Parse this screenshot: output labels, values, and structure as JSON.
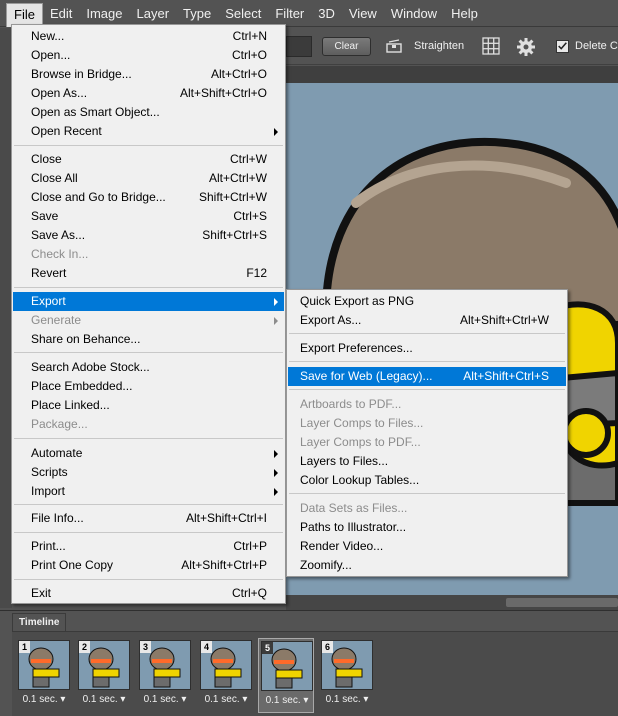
{
  "menubar": {
    "items": [
      "File",
      "Edit",
      "Image",
      "Layer",
      "Type",
      "Select",
      "Filter",
      "3D",
      "View",
      "Window",
      "Help"
    ]
  },
  "optionsbar": {
    "clear_label": "Clear",
    "straighten_label": "Straighten",
    "delete_label": "Delete Cro",
    "delete_checked": true
  },
  "file_menu": {
    "items": [
      {
        "label": "New...",
        "shortcut": "Ctrl+N"
      },
      {
        "label": "Open...",
        "shortcut": "Ctrl+O"
      },
      {
        "label": "Browse in Bridge...",
        "shortcut": "Alt+Ctrl+O"
      },
      {
        "label": "Open As...",
        "shortcut": "Alt+Shift+Ctrl+O"
      },
      {
        "label": "Open as Smart Object...",
        "shortcut": ""
      },
      {
        "label": "Open Recent",
        "shortcut": "",
        "submenu": true
      },
      {
        "label": "Close",
        "shortcut": "Ctrl+W"
      },
      {
        "label": "Close All",
        "shortcut": "Alt+Ctrl+W"
      },
      {
        "label": "Close and Go to Bridge...",
        "shortcut": "Shift+Ctrl+W"
      },
      {
        "label": "Save",
        "shortcut": "Ctrl+S"
      },
      {
        "label": "Save As...",
        "shortcut": "Shift+Ctrl+S"
      },
      {
        "label": "Check In...",
        "shortcut": "",
        "disabled": true
      },
      {
        "label": "Revert",
        "shortcut": "F12"
      },
      {
        "label": "Export",
        "shortcut": "",
        "submenu": true,
        "highlighted": true
      },
      {
        "label": "Generate",
        "shortcut": "",
        "submenu": true,
        "disabled": true
      },
      {
        "label": "Share on Behance...",
        "shortcut": ""
      },
      {
        "label": "Search Adobe Stock...",
        "shortcut": ""
      },
      {
        "label": "Place Embedded...",
        "shortcut": ""
      },
      {
        "label": "Place Linked...",
        "shortcut": ""
      },
      {
        "label": "Package...",
        "shortcut": "",
        "disabled": true
      },
      {
        "label": "Automate",
        "shortcut": "",
        "submenu": true
      },
      {
        "label": "Scripts",
        "shortcut": "",
        "submenu": true
      },
      {
        "label": "Import",
        "shortcut": "",
        "submenu": true
      },
      {
        "label": "File Info...",
        "shortcut": "Alt+Shift+Ctrl+I"
      },
      {
        "label": "Print...",
        "shortcut": "Ctrl+P"
      },
      {
        "label": "Print One Copy",
        "shortcut": "Alt+Shift+Ctrl+P"
      },
      {
        "label": "Exit",
        "shortcut": "Ctrl+Q"
      }
    ]
  },
  "export_menu": {
    "items": [
      {
        "label": "Quick Export as PNG",
        "shortcut": ""
      },
      {
        "label": "Export As...",
        "shortcut": "Alt+Shift+Ctrl+W"
      },
      {
        "label": "Export Preferences...",
        "shortcut": ""
      },
      {
        "label": "Save for Web (Legacy)...",
        "shortcut": "Alt+Shift+Ctrl+S",
        "highlighted": true
      },
      {
        "label": "Artboards to PDF...",
        "shortcut": "",
        "disabled": true
      },
      {
        "label": "Layer Comps to Files...",
        "shortcut": "",
        "disabled": true
      },
      {
        "label": "Layer Comps to PDF...",
        "shortcut": "",
        "disabled": true
      },
      {
        "label": "Layers to Files...",
        "shortcut": ""
      },
      {
        "label": "Color Lookup Tables...",
        "shortcut": ""
      },
      {
        "label": "Data Sets as Files...",
        "shortcut": "",
        "disabled": true
      },
      {
        "label": "Paths to Illustrator...",
        "shortcut": ""
      },
      {
        "label": "Render Video...",
        "shortcut": ""
      },
      {
        "label": "Zoomify...",
        "shortcut": ""
      }
    ]
  },
  "timeline": {
    "tab_label": "Timeline",
    "frames": [
      {
        "number": "1",
        "duration": "0.1 sec. ▾"
      },
      {
        "number": "2",
        "duration": "0.1 sec. ▾"
      },
      {
        "number": "3",
        "duration": "0.1 sec. ▾"
      },
      {
        "number": "4",
        "duration": "0.1 sec. ▾"
      },
      {
        "number": "5",
        "duration": "0.1 sec. ▾",
        "selected": true
      },
      {
        "number": "6",
        "duration": "0.1 sec. ▾"
      }
    ]
  },
  "colors": {
    "highlight": "#0078d7",
    "menu_bg": "#f0f0f0",
    "chrome": "#535353",
    "canvas": "#7f9bb0"
  }
}
